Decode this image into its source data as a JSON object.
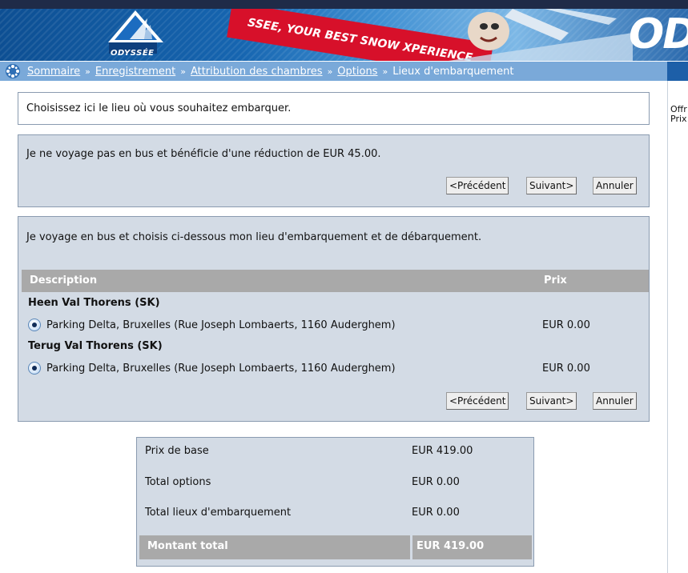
{
  "banner": {
    "logo_text": "ODYSSÉE",
    "slogan": "SSEE, YOUR BEST SNOW XPERIENCE",
    "brand_partial": "OD"
  },
  "breadcrumb": {
    "items": [
      "Sommaire",
      "Enregistrement",
      "Attribution des chambres",
      "Options"
    ],
    "separator": "»",
    "current": "Lieux d'embarquement"
  },
  "right_panel": {
    "line1": "Offr",
    "line2": "Prix"
  },
  "info": {
    "text": "Choisissez ici le lieu où vous souhaitez embarquer."
  },
  "no_bus": {
    "text": "Je ne voyage pas en bus et bénéficie d'une réduction de EUR 45.00.",
    "prev_label": "<Précédent",
    "next_label": "Suivant>",
    "cancel_label": "Annuler"
  },
  "bus": {
    "text": "Je voyage en bus et choisis ci-dessous mon lieu d'embarquement et de débarquement.",
    "columns": {
      "description": "Description",
      "price": "Prix"
    },
    "groups": [
      {
        "title": "Heen Val Thorens (SK)",
        "option": "Parking Delta, Bruxelles (Rue Joseph Lombaerts, 1160 Auderghem)",
        "price": "EUR 0.00",
        "selected": true
      },
      {
        "title": "Terug Val Thorens (SK)",
        "option": "Parking Delta, Bruxelles (Rue Joseph Lombaerts, 1160 Auderghem)",
        "price": "EUR 0.00",
        "selected": true
      }
    ],
    "prev_label": "<Précédent",
    "next_label": "Suivant>",
    "cancel_label": "Annuler"
  },
  "summary": {
    "rows": [
      {
        "label": "Prix de base",
        "value": "EUR 419.00"
      },
      {
        "label": "Total options",
        "value": "EUR 0.00"
      },
      {
        "label": "Total lieux d'embarquement",
        "value": "EUR 0.00"
      }
    ],
    "total_label": "Montant total",
    "total_value": "EUR 419.00"
  },
  "colors": {
    "panel_bg": "#d3dbe5",
    "header_gray": "#a9a9a9",
    "breadcrumb_bg": "#7aa9d9",
    "brand_red": "#d7102a"
  }
}
